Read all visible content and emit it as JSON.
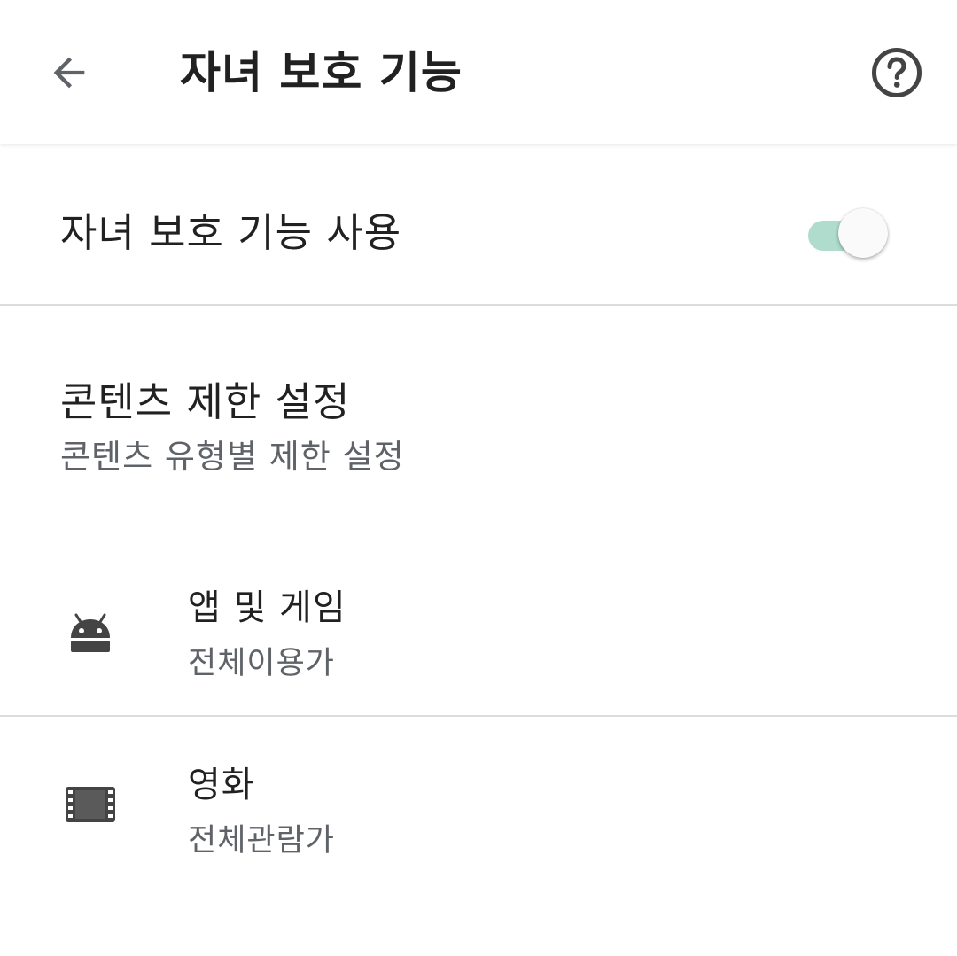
{
  "toolbar": {
    "title": "자녀 보호 기능",
    "back_icon": "arrow-back-icon",
    "help_icon": "help-circle-icon"
  },
  "master_switch": {
    "label": "자녀 보호 기능 사용",
    "state": "on",
    "accent_color": "#b0dccd"
  },
  "content_section": {
    "title": "콘텐츠 제한 설정",
    "subtitle": "콘텐츠 유형별 제한 설정"
  },
  "categories": [
    {
      "icon": "android-icon",
      "title": "앱 및 게임",
      "value": "전체이용가"
    },
    {
      "icon": "movie-film-icon",
      "title": "영화",
      "value": "전체관람가"
    }
  ]
}
